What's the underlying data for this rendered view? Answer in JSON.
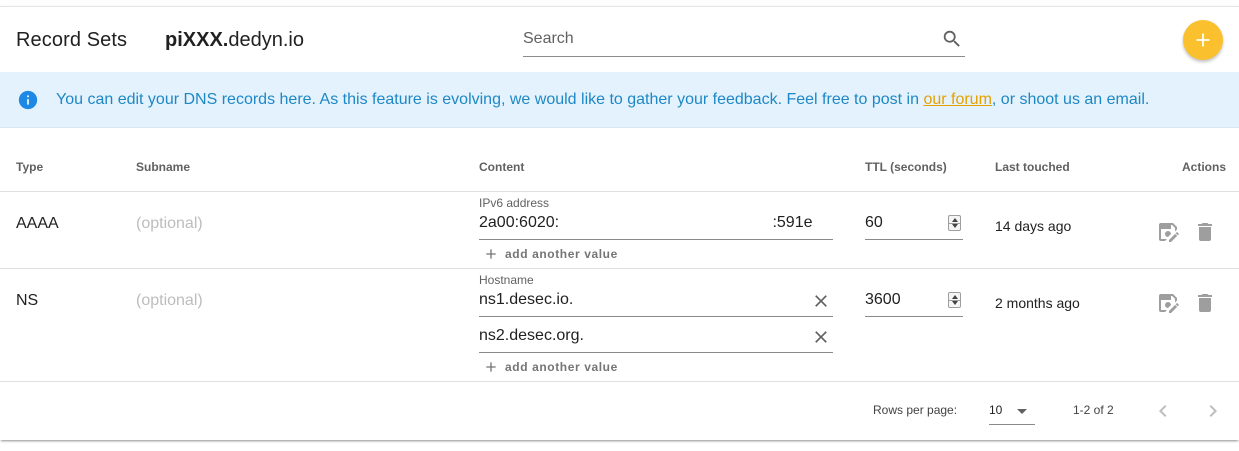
{
  "toolbar": {
    "title": "Record Sets",
    "domain_bold": "piXXX.",
    "domain_rest": "dedyn.io",
    "search_placeholder": "Search",
    "search_icon": "magnify-icon",
    "add_icon": "plus-icon",
    "accent_color": "#fbc02d"
  },
  "alert": {
    "icon": "information-icon",
    "text_before": "You can edit your DNS records here. As this feature is evolving, we would like to gather your feedback. Feel free to post in ",
    "link_text": "our forum",
    "text_after": ", or shoot us an email.",
    "text_color": "#1e88c5",
    "background": "#e3f2fd"
  },
  "table": {
    "headers": {
      "type": "Type",
      "subname": "Subname",
      "content": "Content",
      "ttl": "TTL (seconds)",
      "last_touched": "Last touched",
      "actions": "Actions"
    },
    "add_value_label": "add another value",
    "rows": [
      {
        "type": "AAAA",
        "subname_placeholder": "(optional)",
        "content_label": "IPv6 address",
        "values": [
          "2a00:6020:                                                :591e"
        ],
        "ttl": "60",
        "last_touched": "14 days ago"
      },
      {
        "type": "NS",
        "subname_placeholder": "(optional)",
        "content_label": "Hostname",
        "values": [
          "ns1.desec.io.",
          "ns2.desec.org."
        ],
        "ttl": "3600",
        "last_touched": "2 months ago"
      }
    ]
  },
  "footer": {
    "rows_per_page_label": "Rows per page:",
    "rows_per_page_value": "10",
    "range": "1-2 of 2"
  }
}
